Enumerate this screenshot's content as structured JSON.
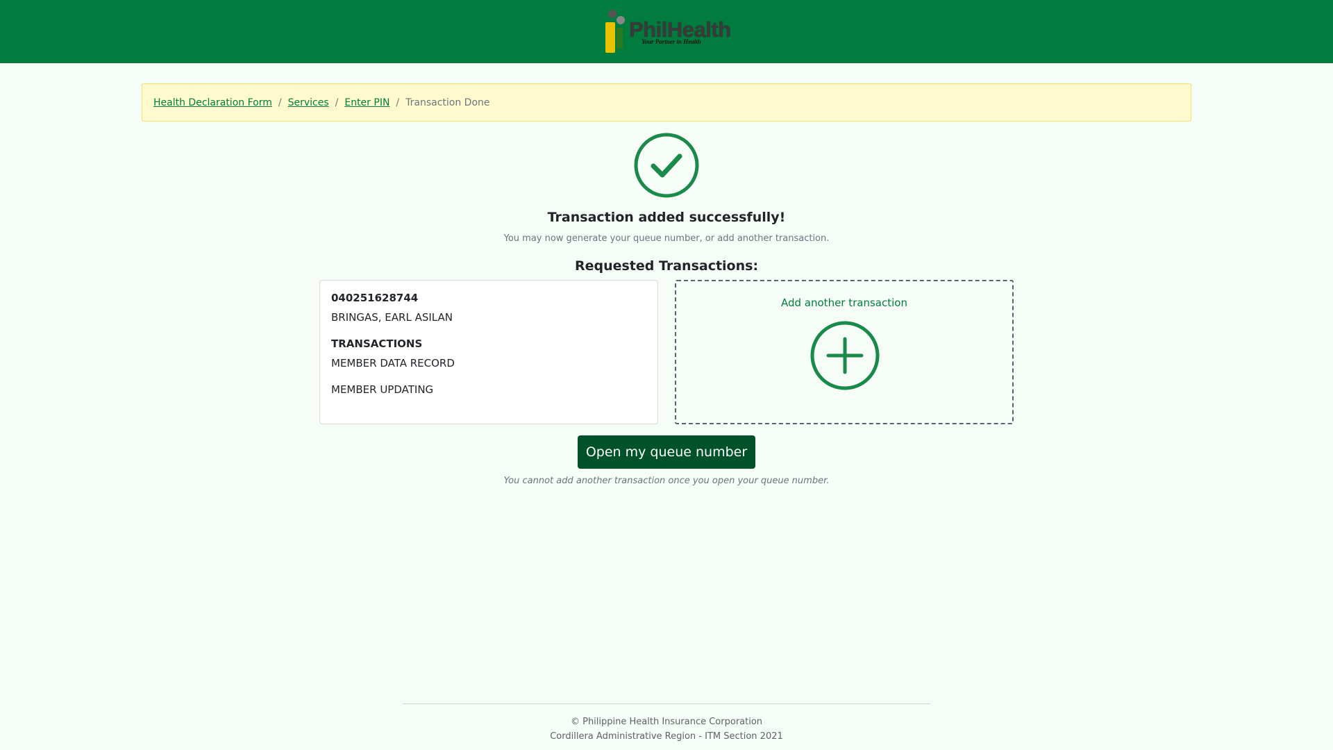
{
  "header": {
    "logo_text": "PhilHealth",
    "logo_tagline": "Your Partner in Health"
  },
  "breadcrumb": {
    "items": [
      {
        "label": "Health Declaration Form"
      },
      {
        "label": "Services"
      },
      {
        "label": "Enter PIN"
      }
    ],
    "current": "Transaction Done",
    "separator": "/"
  },
  "status": {
    "title": "Transaction added successfully!",
    "subtitle": "You may now generate your queue number, or add another transaction."
  },
  "requested": {
    "title": "Requested Transactions:",
    "card": {
      "pin": "040251628744",
      "name": "BRINGAS, EARL ASILAN",
      "transactions_title": "TRANSACTIONS",
      "transactions": [
        "MEMBER DATA RECORD",
        "MEMBER UPDATING"
      ]
    },
    "add_label": "Add another transaction"
  },
  "queue": {
    "button_label": "Open my queue number",
    "note": "You cannot add another transaction once you open your queue number."
  },
  "footer": {
    "line1": "© Philippine Health Insurance Corporation",
    "line2": "Cordillera Administrative Region - ITM Section 2021"
  },
  "icons": {
    "logo": "philhealth-logo-icon",
    "success": "check-circle-icon",
    "add": "plus-circle-icon"
  },
  "colors": {
    "brand_green": "#007d3e",
    "button_dark_green": "#00522a",
    "breadcrumb_bg": "#fffacd",
    "page_bg": "#f6fcf6"
  }
}
